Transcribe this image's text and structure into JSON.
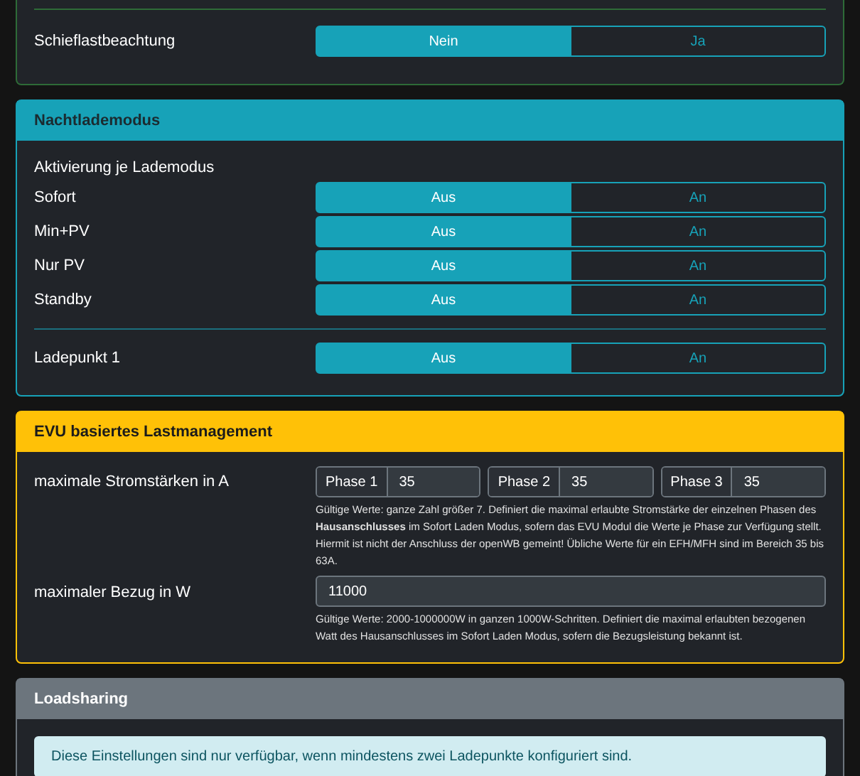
{
  "top_card": {
    "rows": [
      {
        "label": "Schieflastbeachtung",
        "options": [
          {
            "label": "Nein",
            "selected": true
          },
          {
            "label": "Ja",
            "selected": false
          }
        ]
      }
    ]
  },
  "nachtlademodus": {
    "title": "Nachtlademodus",
    "subtitle": "Aktivierung je Lademodus",
    "rows": [
      {
        "label": "Sofort",
        "options": [
          {
            "label": "Aus",
            "selected": true
          },
          {
            "label": "An",
            "selected": false
          }
        ]
      },
      {
        "label": "Min+PV",
        "options": [
          {
            "label": "Aus",
            "selected": true
          },
          {
            "label": "An",
            "selected": false
          }
        ]
      },
      {
        "label": "Nur PV",
        "options": [
          {
            "label": "Aus",
            "selected": true
          },
          {
            "label": "An",
            "selected": false
          }
        ]
      },
      {
        "label": "Standby",
        "options": [
          {
            "label": "Aus",
            "selected": true
          },
          {
            "label": "An",
            "selected": false
          }
        ]
      }
    ],
    "rows_2": [
      {
        "label": "Ladepunkt 1",
        "options": [
          {
            "label": "Aus",
            "selected": true
          },
          {
            "label": "An",
            "selected": false
          }
        ]
      }
    ]
  },
  "evu": {
    "title": "EVU basiertes Lastmanagement",
    "current": {
      "label": "maximale Stromstärken in A",
      "phases": [
        {
          "label": "Phase 1",
          "value": "35"
        },
        {
          "label": "Phase 2",
          "value": "35"
        },
        {
          "label": "Phase 3",
          "value": "35"
        }
      ],
      "help": "Gültige Werte: ganze Zahl größer 7. Definiert die maximal erlaubte Stromstärke der einzelnen Phasen des **Hausanschlusses** im Sofort Laden Modus, sofern das EVU Modul die Werte je Phase zur Verfügung stellt. Hiermit ist nicht der Anschluss der openWB gemeint! Übliche Werte für ein EFH/MFH sind im Bereich 35 bis 63A."
    },
    "power": {
      "label": "maximaler Bezug in W",
      "value": "11000",
      "help": "Gültige Werte: 2000-1000000W in ganzen 1000W-Schritten. Definiert die maximal erlaubten bezogenen Watt des Hausanschlusses im Sofort Laden Modus, sofern die Bezugsleistung bekannt ist."
    }
  },
  "loadsharing": {
    "title": "Loadsharing",
    "alert": "Diese Einstellungen sind nur verfügbar, wenn mindestens zwei Ladepunkte konfiguriert sind."
  }
}
